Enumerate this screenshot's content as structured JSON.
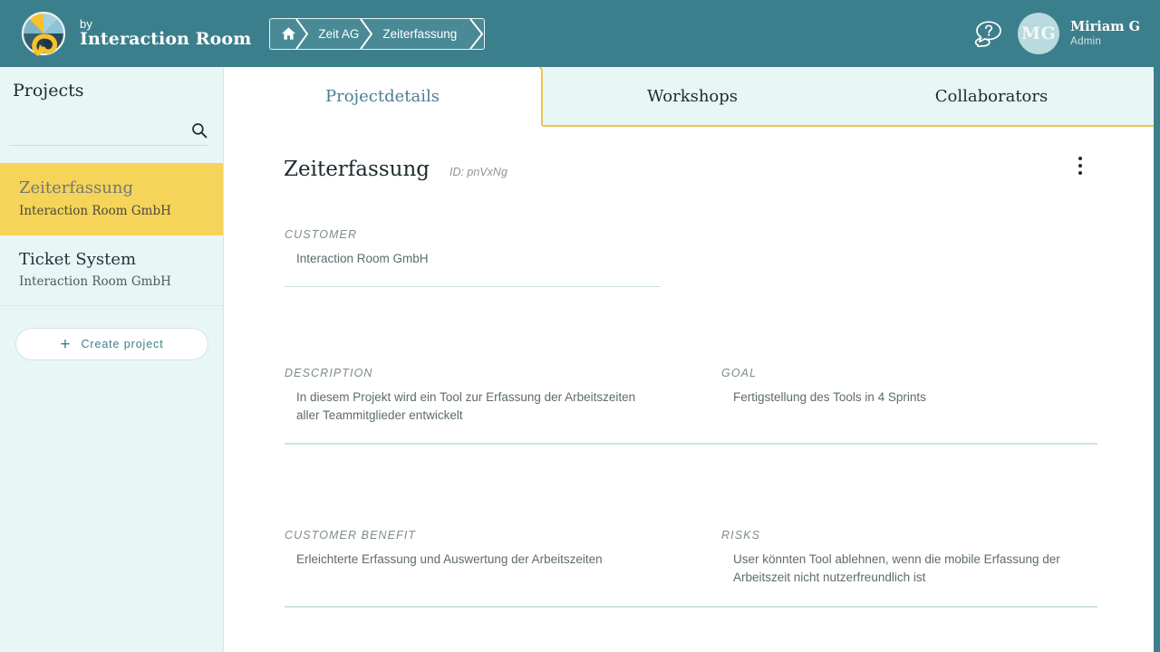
{
  "brand": {
    "by_label": "by",
    "name": "Interaction Room",
    "logo_icon": "interaction-room-logo"
  },
  "breadcrumb": {
    "home_icon": "home-icon",
    "items": [
      {
        "label": "Zeit AG"
      },
      {
        "label": "Zeiterfassung"
      }
    ]
  },
  "topbar": {
    "help_icon": "help-chat-icon",
    "user": {
      "initials": "MG",
      "name": "Miriam G",
      "role": "Admin"
    },
    "colors": {
      "bar_background": "#3c7f8c",
      "breadcrumb_background": "#4a8a96",
      "avatar_background": "#b9dade"
    }
  },
  "sidebar": {
    "title": "Projects",
    "search": {
      "value": "",
      "placeholder": "",
      "icon": "search-icon"
    },
    "projects": [
      {
        "name": "Zeiterfassung",
        "customer": "Interaction Room GmbH",
        "active": true
      },
      {
        "name": "Ticket System",
        "customer": "Interaction Room GmbH",
        "active": false
      }
    ],
    "create_button": {
      "label": "Create project",
      "icon": "plus-icon"
    },
    "colors": {
      "background": "#e9f6f6",
      "active_project": "#f6d359"
    }
  },
  "tabs": [
    {
      "label": "Projectdetails",
      "active": true
    },
    {
      "label": "Workshops",
      "active": false
    },
    {
      "label": "Collaborators",
      "active": false
    }
  ],
  "project": {
    "title": "Zeiterfassung",
    "id_label": "ID: pnVxNg",
    "menu_icon": "kebab-menu-icon",
    "fields": {
      "customer": {
        "label": "CUSTOMER",
        "value": "Interaction Room GmbH"
      },
      "description": {
        "label": "DESCRIPTION",
        "value": "In diesem Projekt wird ein Tool zur Erfassung der Arbeitszeiten aller Teammitglieder entwickelt"
      },
      "goal": {
        "label": "GOAL",
        "value": "Fertigstellung des Tools in 4 Sprints"
      },
      "customer_benefit": {
        "label": "CUSTOMER BENEFIT",
        "value": "Erleichterte Erfassung und Auswertung der Arbeitszeiten"
      },
      "risks": {
        "label": "RISKS",
        "value": "User könnten Tool ablehnen, wenn die mobile Erfassung der Arbeitszeit nicht nutzerfreundlich ist"
      }
    }
  },
  "theme": {
    "accent_teal": "#3c7f8c",
    "accent_gold": "#e9c34d",
    "panel_light": "#e9f6f6"
  }
}
